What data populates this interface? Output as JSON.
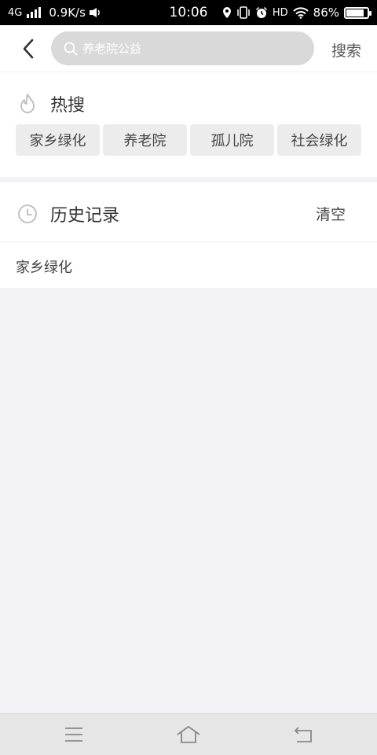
{
  "status_bar": {
    "network": "4G",
    "speed": "0.9K/s",
    "time": "10:06",
    "hd": "HD",
    "battery": "86%",
    "battery_level": 0.86
  },
  "search": {
    "placeholder": "养老院公益",
    "button_label": "搜索"
  },
  "hot": {
    "title": "热搜",
    "tags": [
      "家乡绿化",
      "养老院",
      "孤儿院",
      "社会绿化"
    ]
  },
  "history": {
    "title": "历史记录",
    "clear_label": "清空",
    "items": [
      "家乡绿化"
    ]
  },
  "icons": {
    "back": "back-arrow-icon",
    "search": "search-icon",
    "hot": "flame-icon",
    "history": "clock-icon",
    "nav_menu": "menu-icon",
    "nav_home": "home-icon",
    "nav_back": "return-icon"
  }
}
